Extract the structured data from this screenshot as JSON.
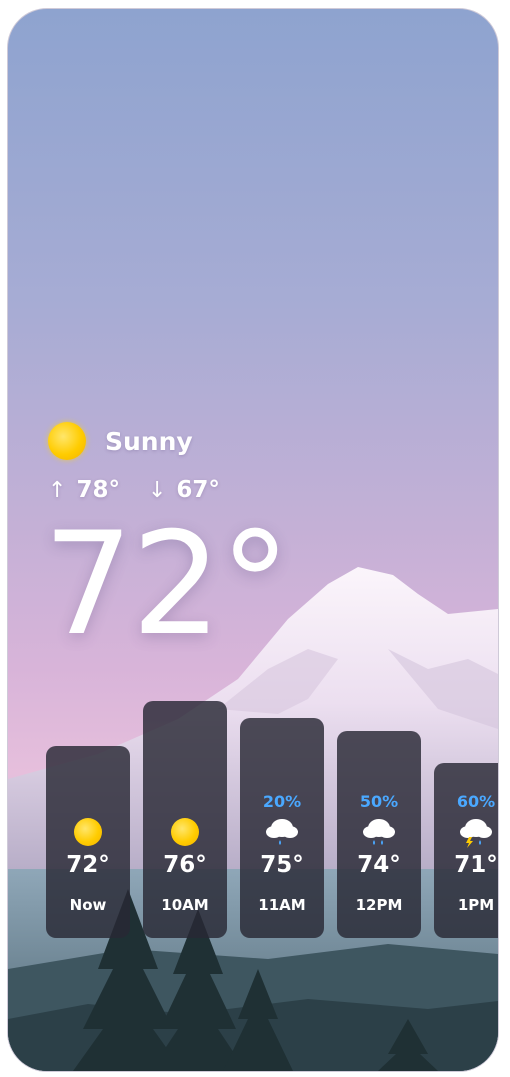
{
  "current": {
    "condition": "Sunny",
    "condition_icon": "sun-icon",
    "high": "78°",
    "low": "67°",
    "temperature": "72°"
  },
  "hourly": [
    {
      "time": "Now",
      "temp": "72°",
      "precip": "",
      "icon": "sun-icon"
    },
    {
      "time": "10AM",
      "temp": "76°",
      "precip": "",
      "icon": "sun-icon"
    },
    {
      "time": "11AM",
      "temp": "75°",
      "precip": "20%",
      "icon": "rain-cloud-icon"
    },
    {
      "time": "12PM",
      "temp": "74°",
      "precip": "50%",
      "icon": "rain-cloud-icon"
    },
    {
      "time": "1PM",
      "temp": "71°",
      "precip": "60%",
      "icon": "thunderstorm-icon"
    }
  ],
  "colors": {
    "precip": "#4aa8ff",
    "sun": "#ffcc00",
    "card": "#28283a"
  }
}
